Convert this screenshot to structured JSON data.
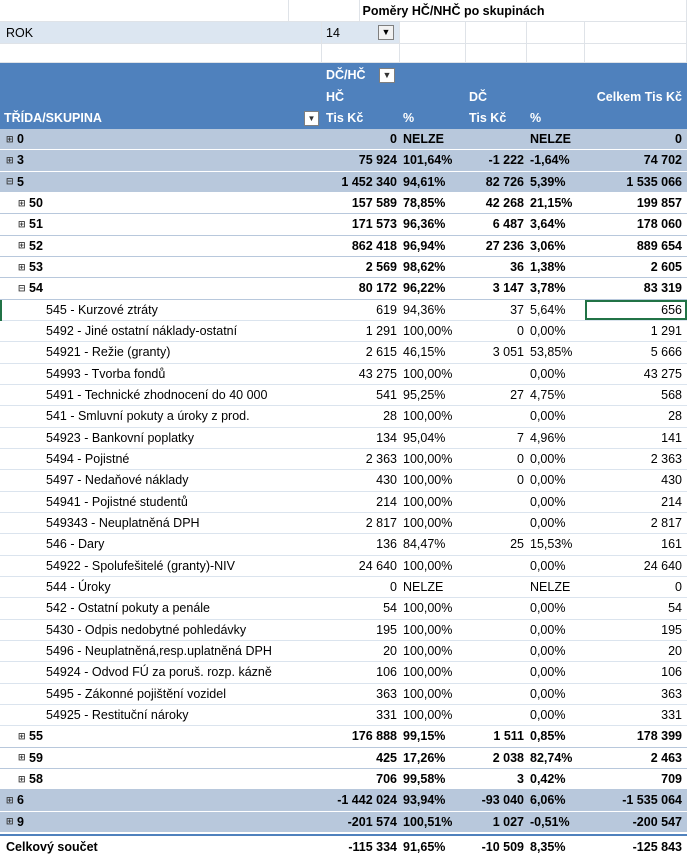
{
  "title": "Poměry HČ/NHČ po skupinách",
  "filter": {
    "label": "ROK",
    "value": "14"
  },
  "header": {
    "col_field": "DČ/HČ",
    "row_field": "TŘÍDA/SKUPINA",
    "group_hc": "HČ",
    "group_dc": "DČ",
    "tis_kc": "Tis Kč",
    "pct": "%",
    "total": "Celkem Tis Kč"
  },
  "rows": [
    {
      "label": "0",
      "sign": "⊞",
      "level": 1,
      "hc": "0",
      "hc_pct": "NELZE",
      "dc": "",
      "dc_pct": "NELZE",
      "total": "0"
    },
    {
      "label": "3",
      "sign": "⊞",
      "level": 1,
      "hc": "75 924",
      "hc_pct": "101,64%",
      "dc": "-1 222",
      "dc_pct": "-1,64%",
      "total": "74 702"
    },
    {
      "label": "5",
      "sign": "⊟",
      "level": 1,
      "hc": "1 452 340",
      "hc_pct": "94,61%",
      "dc": "82 726",
      "dc_pct": "5,39%",
      "total": "1 535 066"
    },
    {
      "label": "50",
      "sign": "⊞",
      "level": 2,
      "hc": "157 589",
      "hc_pct": "78,85%",
      "dc": "42 268",
      "dc_pct": "21,15%",
      "total": "199 857"
    },
    {
      "label": "51",
      "sign": "⊞",
      "level": 2,
      "hc": "171 573",
      "hc_pct": "96,36%",
      "dc": "6 487",
      "dc_pct": "3,64%",
      "total": "178 060"
    },
    {
      "label": "52",
      "sign": "⊞",
      "level": 2,
      "hc": "862 418",
      "hc_pct": "96,94%",
      "dc": "27 236",
      "dc_pct": "3,06%",
      "total": "889 654"
    },
    {
      "label": "53",
      "sign": "⊞",
      "level": 2,
      "hc": "2 569",
      "hc_pct": "98,62%",
      "dc": "36",
      "dc_pct": "1,38%",
      "total": "2 605"
    },
    {
      "label": "54",
      "sign": "⊟",
      "level": 2,
      "hc": "80 172",
      "hc_pct": "96,22%",
      "dc": "3 147",
      "dc_pct": "3,78%",
      "total": "83 319"
    },
    {
      "label": "545 - Kurzové ztráty",
      "sign": "",
      "level": 3,
      "hc": "619",
      "hc_pct": "94,36%",
      "dc": "37",
      "dc_pct": "5,64%",
      "total": "656",
      "selected": true
    },
    {
      "label": "5492 - Jiné ostatní náklady-ostatní",
      "sign": "",
      "level": 3,
      "hc": "1 291",
      "hc_pct": "100,00%",
      "dc": "0",
      "dc_pct": "0,00%",
      "total": "1 291"
    },
    {
      "label": "54921 - Režie (granty)",
      "sign": "",
      "level": 3,
      "hc": "2 615",
      "hc_pct": "46,15%",
      "dc": "3 051",
      "dc_pct": "53,85%",
      "total": "5 666"
    },
    {
      "label": "54993 - Tvorba fondů",
      "sign": "",
      "level": 3,
      "hc": "43 275",
      "hc_pct": "100,00%",
      "dc": "",
      "dc_pct": "0,00%",
      "total": "43 275"
    },
    {
      "label": "5491 - Technické zhodnocení do 40 000",
      "sign": "",
      "level": 3,
      "hc": "541",
      "hc_pct": "95,25%",
      "dc": "27",
      "dc_pct": "4,75%",
      "total": "568"
    },
    {
      "label": "541 - Smluvní pokuty a úroky z prod.",
      "sign": "",
      "level": 3,
      "hc": "28",
      "hc_pct": "100,00%",
      "dc": "",
      "dc_pct": "0,00%",
      "total": "28"
    },
    {
      "label": "54923 - Bankovní poplatky",
      "sign": "",
      "level": 3,
      "hc": "134",
      "hc_pct": "95,04%",
      "dc": "7",
      "dc_pct": "4,96%",
      "total": "141"
    },
    {
      "label": "5494 - Pojistné",
      "sign": "",
      "level": 3,
      "hc": "2 363",
      "hc_pct": "100,00%",
      "dc": "0",
      "dc_pct": "0,00%",
      "total": "2 363"
    },
    {
      "label": "5497 - Nedaňové náklady",
      "sign": "",
      "level": 3,
      "hc": "430",
      "hc_pct": "100,00%",
      "dc": "0",
      "dc_pct": "0,00%",
      "total": "430"
    },
    {
      "label": "54941 - Pojistné studentů",
      "sign": "",
      "level": 3,
      "hc": "214",
      "hc_pct": "100,00%",
      "dc": "",
      "dc_pct": "0,00%",
      "total": "214"
    },
    {
      "label": "549343 - Neuplatněná DPH",
      "sign": "",
      "level": 3,
      "hc": "2 817",
      "hc_pct": "100,00%",
      "dc": "",
      "dc_pct": "0,00%",
      "total": "2 817"
    },
    {
      "label": "546 - Dary",
      "sign": "",
      "level": 3,
      "hc": "136",
      "hc_pct": "84,47%",
      "dc": "25",
      "dc_pct": "15,53%",
      "total": "161"
    },
    {
      "label": "54922 - Spolufešitelé (granty)-NIV",
      "sign": "",
      "level": 3,
      "hc": "24 640",
      "hc_pct": "100,00%",
      "dc": "",
      "dc_pct": "0,00%",
      "total": "24 640"
    },
    {
      "label": "544 - Úroky",
      "sign": "",
      "level": 3,
      "hc": "0",
      "hc_pct": "NELZE",
      "dc": "",
      "dc_pct": "NELZE",
      "total": "0"
    },
    {
      "label": "542 - Ostatní pokuty a penále",
      "sign": "",
      "level": 3,
      "hc": "54",
      "hc_pct": "100,00%",
      "dc": "",
      "dc_pct": "0,00%",
      "total": "54"
    },
    {
      "label": "5430 - Odpis nedobytné pohledávky",
      "sign": "",
      "level": 3,
      "hc": "195",
      "hc_pct": "100,00%",
      "dc": "",
      "dc_pct": "0,00%",
      "total": "195"
    },
    {
      "label": "5496 - Neuplatněná,resp.uplatněná DPH",
      "sign": "",
      "level": 3,
      "hc": "20",
      "hc_pct": "100,00%",
      "dc": "",
      "dc_pct": "0,00%",
      "total": "20"
    },
    {
      "label": "54924 - Odvod FÚ za poruš. rozp. kázně",
      "sign": "",
      "level": 3,
      "hc": "106",
      "hc_pct": "100,00%",
      "dc": "",
      "dc_pct": "0,00%",
      "total": "106"
    },
    {
      "label": "5495 - Zákonné pojištění vozidel",
      "sign": "",
      "level": 3,
      "hc": "363",
      "hc_pct": "100,00%",
      "dc": "",
      "dc_pct": "0,00%",
      "total": "363"
    },
    {
      "label": "54925 - Restituční nároky",
      "sign": "",
      "level": 3,
      "hc": "331",
      "hc_pct": "100,00%",
      "dc": "",
      "dc_pct": "0,00%",
      "total": "331"
    },
    {
      "label": "55",
      "sign": "⊞",
      "level": 2,
      "hc": "176 888",
      "hc_pct": "99,15%",
      "dc": "1 511",
      "dc_pct": "0,85%",
      "total": "178 399"
    },
    {
      "label": "59",
      "sign": "⊞",
      "level": 2,
      "hc": "425",
      "hc_pct": "17,26%",
      "dc": "2 038",
      "dc_pct": "82,74%",
      "total": "2 463"
    },
    {
      "label": "58",
      "sign": "⊞",
      "level": 2,
      "hc": "706",
      "hc_pct": "99,58%",
      "dc": "3",
      "dc_pct": "0,42%",
      "total": "709"
    },
    {
      "label": "6",
      "sign": "⊞",
      "level": 1,
      "hc": "-1 442 024",
      "hc_pct": "93,94%",
      "dc": "-93 040",
      "dc_pct": "6,06%",
      "total": "-1 535 064"
    },
    {
      "label": "9",
      "sign": "⊞",
      "level": 1,
      "hc": "-201 574",
      "hc_pct": "100,51%",
      "dc": "1 027",
      "dc_pct": "-0,51%",
      "total": "-200 547"
    }
  ],
  "grand_total": {
    "label": "Celkový součet",
    "hc": "-115 334",
    "hc_pct": "91,65%",
    "dc": "-10 509",
    "dc_pct": "8,35%",
    "total": "-125 843"
  }
}
